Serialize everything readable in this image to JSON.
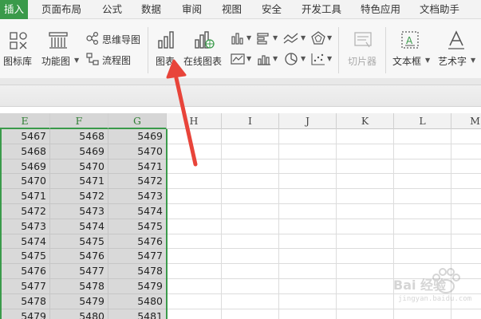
{
  "menu": {
    "items": [
      {
        "label": "插入",
        "active": true
      },
      {
        "label": "页面布局"
      },
      {
        "label": "公式"
      },
      {
        "label": "数据"
      },
      {
        "label": "审阅"
      },
      {
        "label": "视图"
      },
      {
        "label": "安全"
      },
      {
        "label": "开发工具"
      },
      {
        "label": "特色应用"
      },
      {
        "label": "文档助手"
      }
    ]
  },
  "ribbon": {
    "icon_library": "图标库",
    "function_diagram": "功能图",
    "mind_map": "思维导图",
    "flowchart": "流程图",
    "chart": "图表",
    "online_chart": "在线图表",
    "slicer": "切片器",
    "text_box": "文本框",
    "art_text": "艺术字"
  },
  "sheet": {
    "columns": [
      "E",
      "F",
      "G",
      "H",
      "I",
      "J",
      "K",
      "L",
      "M"
    ],
    "rows": [
      [
        "5467",
        "5468",
        "5469"
      ],
      [
        "5468",
        "5469",
        "5470"
      ],
      [
        "5469",
        "5470",
        "5471"
      ],
      [
        "5470",
        "5471",
        "5472"
      ],
      [
        "5471",
        "5472",
        "5473"
      ],
      [
        "5472",
        "5473",
        "5474"
      ],
      [
        "5473",
        "5474",
        "5475"
      ],
      [
        "5474",
        "5475",
        "5476"
      ],
      [
        "5475",
        "5476",
        "5477"
      ],
      [
        "5476",
        "5477",
        "5478"
      ],
      [
        "5477",
        "5478",
        "5479"
      ],
      [
        "5478",
        "5479",
        "5480"
      ],
      [
        "5479",
        "5480",
        "5481"
      ]
    ]
  },
  "watermark": {
    "brand": "Bai 经验",
    "url": "jingyan.baidu.com"
  },
  "colors": {
    "accent": "#3a9a4a",
    "arrow": "#e8443a",
    "selection_fill": "#d9d9d9"
  }
}
